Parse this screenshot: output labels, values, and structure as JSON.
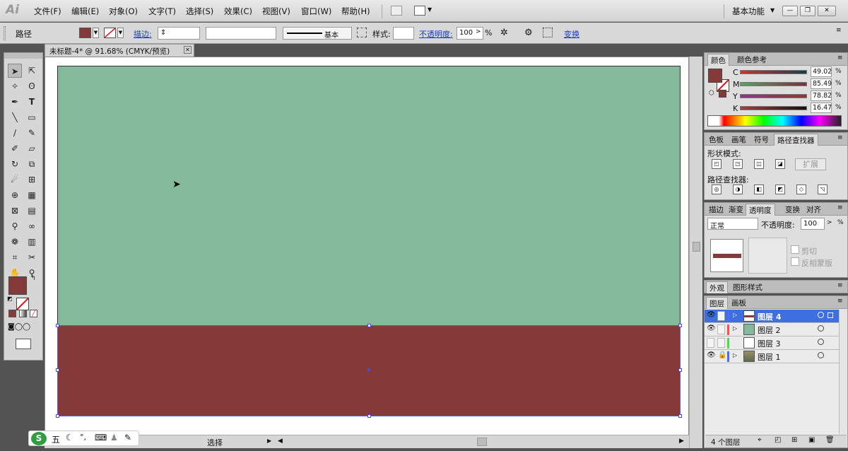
{
  "app": {
    "logo": "Ai"
  },
  "menu": [
    "文件(F)",
    "编辑(E)",
    "对象(O)",
    "文字(T)",
    "选择(S)",
    "效果(C)",
    "视图(V)",
    "窗口(W)",
    "帮助(H)"
  ],
  "workspace": "基本功能",
  "control": {
    "object_type": "路径",
    "stroke_label": "描边:",
    "stroke_style": "基本",
    "style_label": "样式:",
    "opacity_label": "不透明度:",
    "opacity_value": "100",
    "percent": "%",
    "transform_label": "变换",
    "fill_color": "#843a39"
  },
  "document": {
    "tab_title": "未标题-4* @ 91.68% (CMYK/预览)",
    "top_color": "#85b99c",
    "bottom_color": "#843a39"
  },
  "statusbar": {
    "mode": "选择"
  },
  "ime": {
    "label": "五"
  },
  "color_panel": {
    "tabs": [
      "颜色",
      "颜色参考"
    ],
    "channels": [
      {
        "label": "C",
        "value": "49.02"
      },
      {
        "label": "M",
        "value": "85.49"
      },
      {
        "label": "Y",
        "value": "78.82"
      },
      {
        "label": "K",
        "value": "16.47"
      }
    ],
    "unit": "%"
  },
  "pathfinder_panel": {
    "tabs": [
      "色板",
      "画笔",
      "符号",
      "路径查找器"
    ],
    "shape_modes": "形状模式:",
    "expand": "扩展",
    "pathfinders": "路径查找器:"
  },
  "transparency_panel": {
    "tabs": [
      "描边",
      "渐变",
      "透明度",
      "变换",
      "对齐"
    ],
    "blend": "正常",
    "opacity_label": "不透明度:",
    "opacity_value": "100",
    "clip": "剪切",
    "invert": "反相蒙版"
  },
  "appearance_panel": {
    "tabs": [
      "外观",
      "图形样式"
    ]
  },
  "layers_panel": {
    "tabs": [
      "图层",
      "画板"
    ],
    "layers": [
      {
        "name": "图层 4",
        "color": "#4f6bff",
        "selected": true
      },
      {
        "name": "图层 2",
        "color": "#ff4d4d",
        "selected": false
      },
      {
        "name": "图层 3",
        "color": "#4dd94d",
        "selected": false
      },
      {
        "name": "图层 1",
        "color": "#4f6bff",
        "selected": false
      }
    ],
    "count": "4 个图层"
  }
}
